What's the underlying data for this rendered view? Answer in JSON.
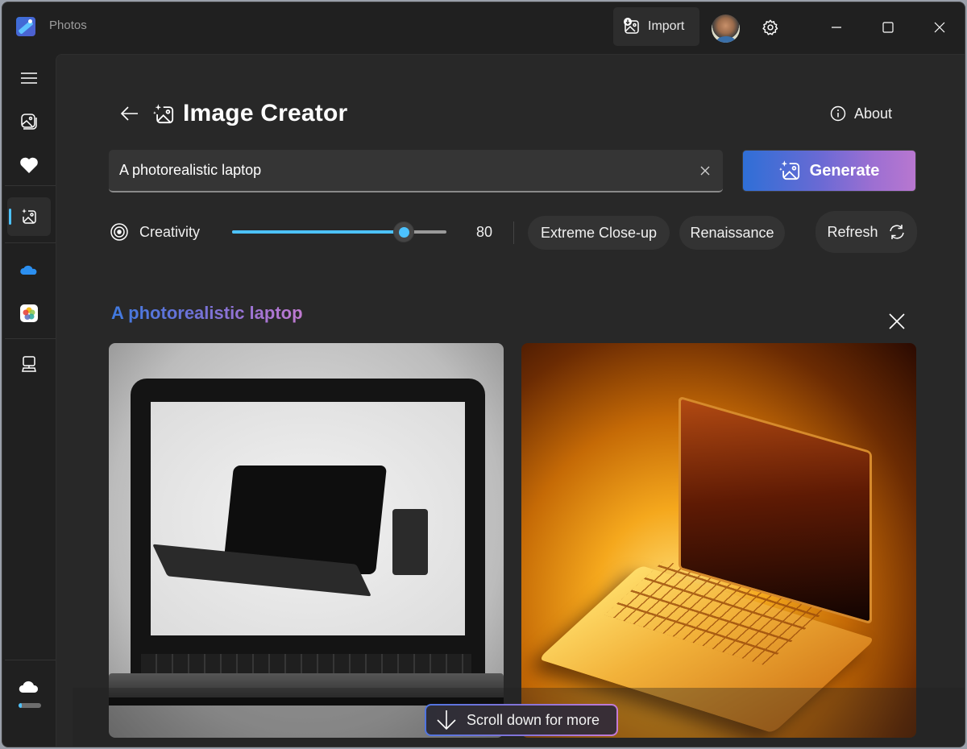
{
  "app": {
    "title": "Photos",
    "colors": {
      "accent": "#4cc2ff",
      "background": "#202020",
      "panel": "#282828",
      "gradient_start": "#2f6fd6",
      "gradient_end": "#b877d0"
    }
  },
  "titlebar": {
    "import_label": "Import",
    "icons": [
      "import-icon",
      "avatar",
      "settings-gear-icon",
      "minimize-icon",
      "maximize-icon",
      "close-icon"
    ]
  },
  "sidebar": {
    "items": [
      {
        "name": "menu",
        "icon": "hamburger-icon"
      },
      {
        "name": "gallery",
        "icon": "gallery-icon"
      },
      {
        "name": "favorites",
        "icon": "heart-icon"
      },
      {
        "name": "image-creator",
        "icon": "image-creator-icon",
        "active": true
      },
      {
        "name": "onedrive",
        "icon": "onedrive-cloud-icon"
      },
      {
        "name": "icloud-photos",
        "icon": "icloud-photos-icon"
      },
      {
        "name": "this-pc",
        "icon": "pc-icon"
      },
      {
        "name": "cloud-storage",
        "icon": "cloud-icon"
      }
    ],
    "storage_used_fraction": 0.15
  },
  "page": {
    "title": "Image Creator",
    "about_label": "About",
    "prompt": {
      "value": "A photorealistic laptop",
      "placeholder": ""
    },
    "generate_label": "Generate",
    "creativity": {
      "label": "Creativity",
      "value": 80,
      "min": 0,
      "max": 100,
      "display": "80"
    },
    "style_chips": [
      "Extreme Close-up",
      "Renaissance"
    ],
    "refresh_label": "Refresh"
  },
  "results": {
    "title": "A photorealistic laptop",
    "images": [
      {
        "alt": "Black-and-white photo of a laptop displaying a laptop and phone"
      },
      {
        "alt": "Golden glowing laptop on an amber background"
      }
    ]
  },
  "scroll_hint": "Scroll down for more"
}
